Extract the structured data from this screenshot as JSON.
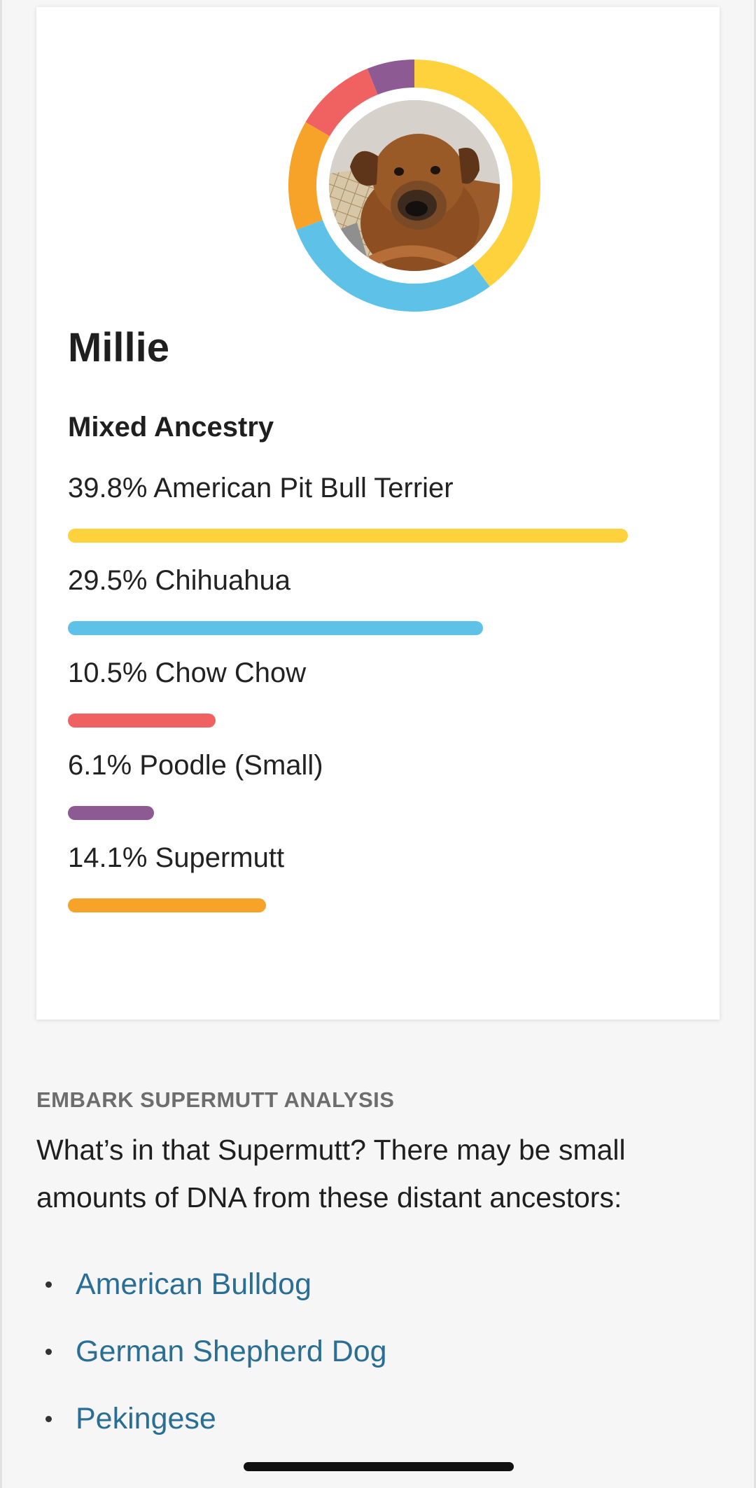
{
  "dog": {
    "name": "Millie"
  },
  "ancestry": {
    "title": "Mixed Ancestry",
    "breeds": [
      {
        "label": "39.8% American Pit Bull Terrier",
        "percent": 39.8,
        "color": "#fdd23c"
      },
      {
        "label": "29.5% Chihuahua",
        "percent": 29.5,
        "color": "#5ec2e8"
      },
      {
        "label": "10.5% Chow Chow",
        "percent": 10.5,
        "color": "#f06262"
      },
      {
        "label": "6.1% Poodle (Small)",
        "percent": 6.1,
        "color": "#8e5a94"
      },
      {
        "label": "14.1% Supermutt",
        "percent": 14.1,
        "color": "#f7a228"
      }
    ]
  },
  "donut_order": [
    0,
    1,
    4,
    2,
    3
  ],
  "supermutt": {
    "eyebrow": "EMBARK SUPERMUTT ANALYSIS",
    "text": "What’s in that Supermutt? There may be small amounts of DNA from these distant ancestors:",
    "ancestors": [
      "American Bulldog",
      "German Shepherd Dog",
      "Pekingese"
    ]
  },
  "colors": {
    "link": "#2a6e96",
    "background": "#f6f6f6",
    "card": "#ffffff"
  }
}
